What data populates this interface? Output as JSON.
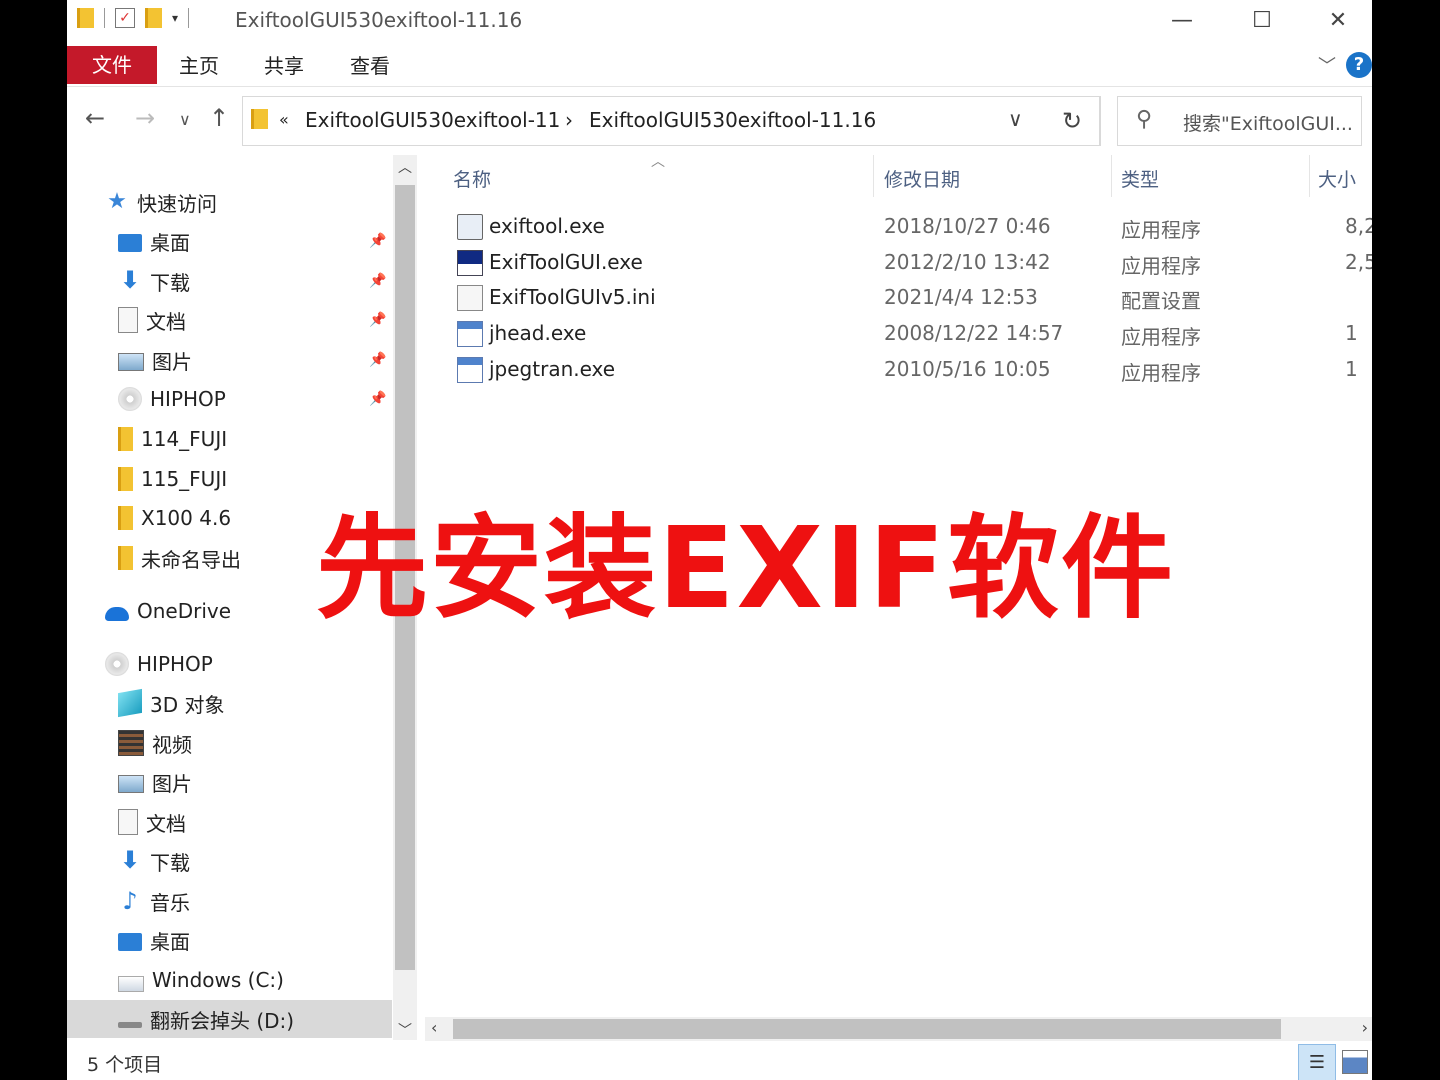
{
  "window": {
    "title": "ExiftoolGUI530exiftool-11.16",
    "buttons": {
      "minimize": "—",
      "maximize": "☐",
      "close": "✕"
    }
  },
  "ribbon": {
    "file": "文件",
    "tabs": [
      "主页",
      "共享",
      "查看"
    ],
    "help": "?"
  },
  "address": {
    "overflow": "«",
    "crumbs": [
      "ExiftoolGUI530exiftool-11",
      "ExiftoolGUI530exiftool-11.16"
    ],
    "separator": "›"
  },
  "search": {
    "placeholder": "搜索\"ExiftoolGUI..."
  },
  "nav": {
    "quick_access": "快速访问",
    "quick_items": [
      {
        "label": "桌面",
        "icon": "desktop-icon",
        "pinned": true
      },
      {
        "label": "下载",
        "icon": "download-icon",
        "pinned": true
      },
      {
        "label": "文档",
        "icon": "document-icon",
        "pinned": true
      },
      {
        "label": "图片",
        "icon": "pictures-icon",
        "pinned": true
      },
      {
        "label": "HIPHOP",
        "icon": "disc-icon",
        "pinned": true
      },
      {
        "label": "114_FUJI",
        "icon": "folder-icon",
        "pinned": false
      },
      {
        "label": "115_FUJI",
        "icon": "folder-icon",
        "pinned": false
      },
      {
        "label": "X100 4.6",
        "icon": "folder-icon",
        "pinned": false
      },
      {
        "label": "未命名导出",
        "icon": "folder-icon",
        "pinned": false
      }
    ],
    "onedrive": "OneDrive",
    "pc": "HIPHOP",
    "pc_items": [
      {
        "label": "3D 对象",
        "icon": "3d-objects-icon"
      },
      {
        "label": "视频",
        "icon": "video-icon"
      },
      {
        "label": "图片",
        "icon": "pictures-icon"
      },
      {
        "label": "文档",
        "icon": "document-icon"
      },
      {
        "label": "下载",
        "icon": "download-icon"
      },
      {
        "label": "音乐",
        "icon": "music-icon"
      },
      {
        "label": "桌面",
        "icon": "desktop-icon"
      },
      {
        "label": "Windows (C:)",
        "icon": "windows-drive-icon"
      },
      {
        "label": "翻新会掉头 (D:)",
        "icon": "drive-icon"
      }
    ]
  },
  "columns": {
    "name": "名称",
    "date": "修改日期",
    "type": "类型",
    "size": "大小"
  },
  "files": [
    {
      "name": "exiftool.exe",
      "date": "2018/10/27 0:46",
      "type": "应用程序",
      "size": "8,2",
      "icon": "exiftool-exe-icon"
    },
    {
      "name": "ExifToolGUI.exe",
      "date": "2012/2/10 13:42",
      "type": "应用程序",
      "size": "2,5",
      "icon": "exiftoolgui-exe-icon"
    },
    {
      "name": "ExifToolGUIv5.ini",
      "date": "2021/4/4 12:53",
      "type": "配置设置",
      "size": "",
      "icon": "ini-file-icon"
    },
    {
      "name": "jhead.exe",
      "date": "2008/12/22 14:57",
      "type": "应用程序",
      "size": "1",
      "icon": "app-exe-icon"
    },
    {
      "name": "jpegtran.exe",
      "date": "2010/5/16 10:05",
      "type": "应用程序",
      "size": "1",
      "icon": "app-exe-icon"
    }
  ],
  "overlay_caption": "先安装EXIF软件",
  "status": {
    "count": "5 个项目"
  },
  "colors": {
    "accent_file_tab": "#c4192a",
    "overlay": "#ee1111",
    "help": "#1a73c8"
  }
}
